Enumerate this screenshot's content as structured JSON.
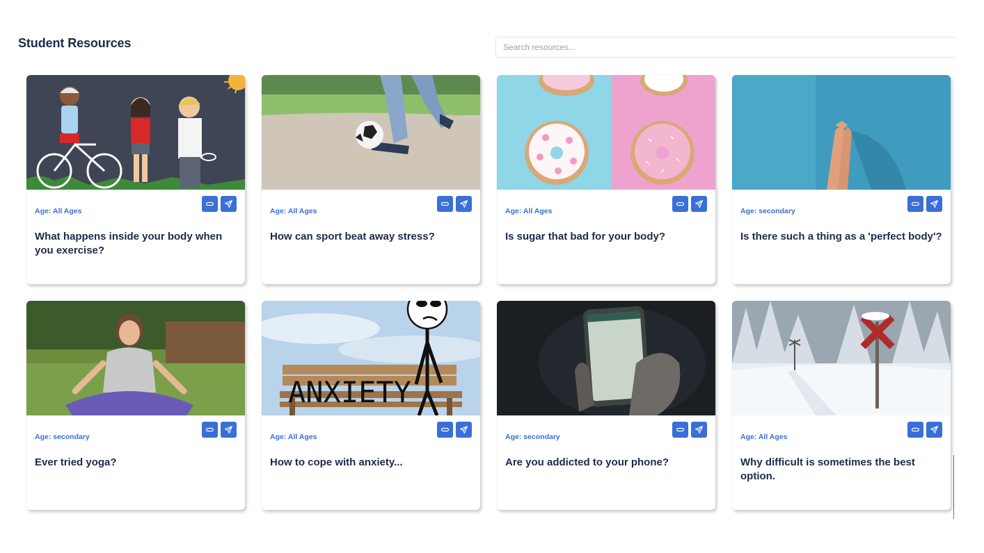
{
  "header": {
    "title": "Student Resources",
    "search_placeholder": "Search resources..."
  },
  "icons": {
    "link": "link-icon",
    "share": "send-icon"
  },
  "colors": {
    "accent": "#3a6fd8",
    "title": "#1e2a4a"
  },
  "cards": [
    {
      "age": "Age: All Ages",
      "title": "What happens inside your body when you exercise?"
    },
    {
      "age": "Age: All Ages",
      "title": "How can sport beat away stress?"
    },
    {
      "age": "Age: All Ages",
      "title": "Is sugar that bad for your body?"
    },
    {
      "age": "Age: secondary",
      "title": "Is there such a thing as a 'perfect body'?"
    },
    {
      "age": "Age: secondary",
      "title": "Ever tried yoga?"
    },
    {
      "age": "Age: All Ages",
      "title": "How to cope with anxiety..."
    },
    {
      "age": "Age: secondary",
      "title": "Are you addicted to your phone?"
    },
    {
      "age": "Age: All Ages",
      "title": "Why difficult is sometimes the best option."
    }
  ],
  "thumb_art": {
    "anxiety_sign": "ANXIETY"
  }
}
